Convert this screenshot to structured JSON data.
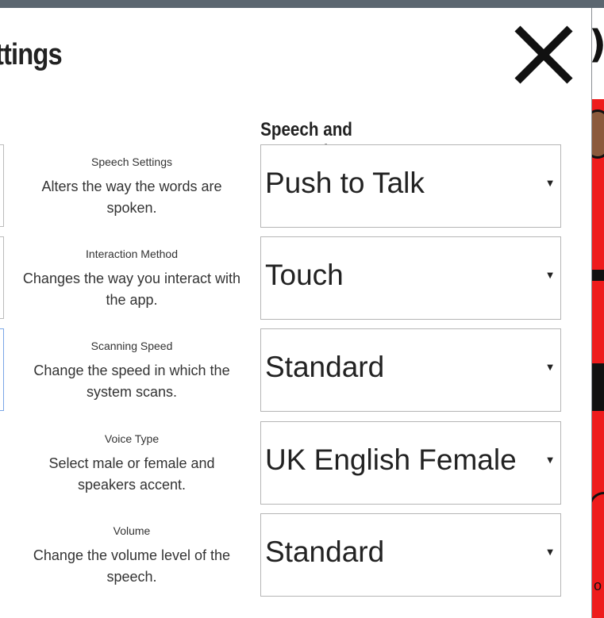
{
  "modal": {
    "title": "ttings",
    "section_title": "Speech and Interaction"
  },
  "settings": [
    {
      "label": "Speech Settings",
      "description": "Alters the way the words are spoken.",
      "value": "Push to Talk"
    },
    {
      "label": "Interaction Method",
      "description": "Changes the way you interact with the app.",
      "value": "Touch"
    },
    {
      "label": "Scanning Speed",
      "description": "Change the speed in which the system scans.",
      "value": "Standard"
    },
    {
      "label": "Voice Type",
      "description": "Select male or female and speakers accent.",
      "value": "UK English Female"
    },
    {
      "label": "Volume",
      "description": "Change the volume level of the speech.",
      "value": "Standard"
    }
  ],
  "background": {
    "partial_glyph": ")",
    "partial_letter": "o"
  },
  "icons": {
    "close": "close-icon",
    "caret": "caret-down-icon"
  },
  "colors": {
    "backdrop": "#5b6670",
    "accent_red": "#ee1c1c",
    "focus_border": "#7aa6e6"
  }
}
